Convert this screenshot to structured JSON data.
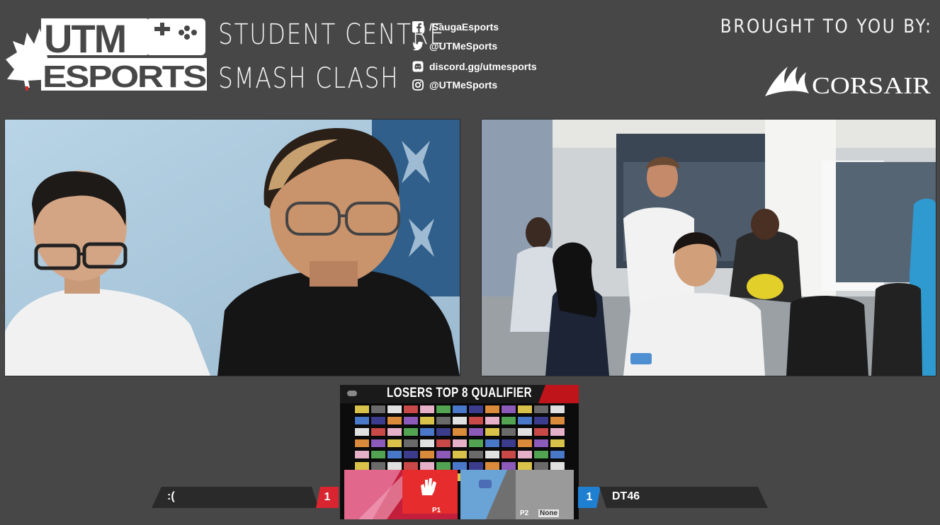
{
  "header": {
    "logo_text_top": "UTM",
    "logo_text_bottom": "ESPORTS",
    "event_line_1": "STUDENT CENTRE",
    "event_line_2": "SMASH CLASH",
    "socials": [
      {
        "icon": "facebook-icon",
        "handle": "/SaugaEsports"
      },
      {
        "icon": "twitter-icon",
        "handle": "@UTMeSports"
      },
      {
        "icon": "discord-icon",
        "handle": "discord.gg/utmesports"
      },
      {
        "icon": "instagram-icon",
        "handle": "@UTMeSports"
      }
    ],
    "sponsor_caption": "BROUGHT TO YOU BY:",
    "sponsor_name": "CORSAIR"
  },
  "game": {
    "round_title": "LOSERS TOP 8 QUALIFIER",
    "hud_p1_tag": "P1",
    "hud_p2_tag": "P2",
    "hud_p2_status": "None"
  },
  "scoreboard": {
    "player1_name": ":(",
    "player1_score": "1",
    "player2_name": "DT46",
    "player2_score": "1"
  },
  "colors": {
    "background": "#474747",
    "player1_accent": "#d9252f",
    "player2_accent": "#1f7fd1",
    "nameplate": "#2a2a2a"
  }
}
